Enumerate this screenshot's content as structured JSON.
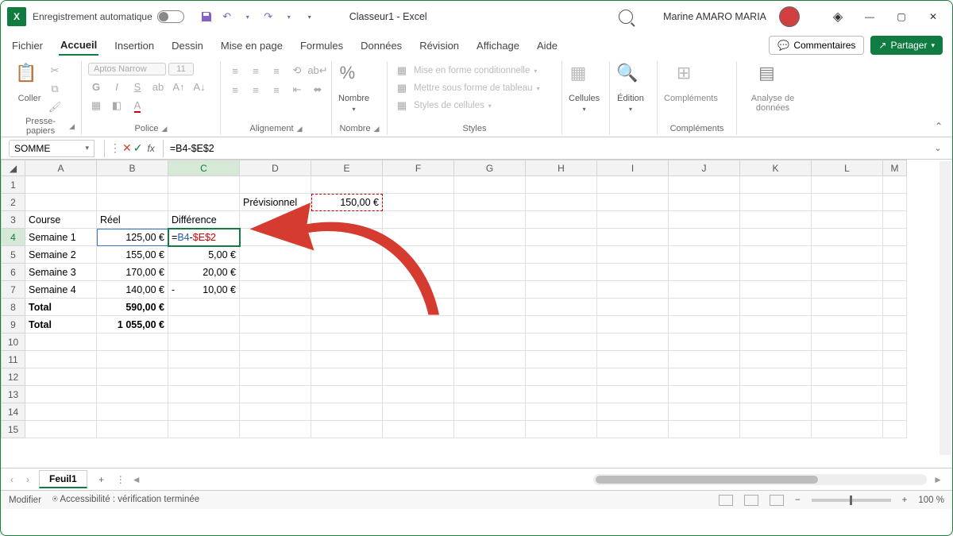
{
  "titlebar": {
    "auto_save": "Enregistrement automatique",
    "doc_title": "Classeur1 - Excel",
    "user": "Marine AMARO MARIA"
  },
  "tabs": {
    "file": "Fichier",
    "home": "Accueil",
    "insert": "Insertion",
    "draw": "Dessin",
    "layout": "Mise en page",
    "formulas": "Formules",
    "data": "Données",
    "review": "Révision",
    "view": "Affichage",
    "help": "Aide",
    "comments": "Commentaires",
    "share": "Partager"
  },
  "ribbon": {
    "clipboard": "Presse-papiers",
    "paste": "Coller",
    "font_group": "Police",
    "font_name": "Aptos Narrow",
    "font_size": "11",
    "align_group": "Alignement",
    "number_group": "Nombre",
    "number_btn": "Nombre",
    "styles_group": "Styles",
    "cond_fmt": "Mise en forme conditionnelle",
    "table_fmt": "Mettre sous forme de tableau",
    "cell_styles": "Styles de cellules",
    "cells_group": "Cellules",
    "cells_btn": "Cellules",
    "edit_group": "Édition",
    "edit_btn": "Édition",
    "addins_group": "Compléments",
    "addins_btn": "Compléments",
    "analyze_group": "",
    "analyze_btn": "Analyse de données"
  },
  "namebox": "SOMME",
  "formula": "=B4-$E$2",
  "columns": [
    "A",
    "B",
    "C",
    "D",
    "E",
    "F",
    "G",
    "H",
    "I",
    "J",
    "K",
    "L",
    "M"
  ],
  "cells": {
    "D2": "Prévisionnel",
    "E2": "150,00 €",
    "A3": "Course",
    "B3": "Réel",
    "C3": "Différence",
    "A4": "Semaine 1",
    "B4": "125,00 €",
    "C4_eq": "=",
    "C4_b": "B4",
    "C4_m": "-",
    "C4_r": "$E$2",
    "A5": "Semaine 2",
    "B5": "155,00 €",
    "C5": "5,00 €",
    "A6": "Semaine 3",
    "B6": "170,00 €",
    "C6": "20,00 €",
    "A7": "Semaine 4",
    "B7": "140,00 €",
    "C7_sign": "-",
    "C7": "10,00 €",
    "A8": "Total",
    "B8": "590,00 €",
    "A9": "Total",
    "B9": "1 055,00 €"
  },
  "sheet_tab": "Feuil1",
  "statusbar": {
    "mode": "Modifier",
    "access": "Accessibilité : vérification terminée",
    "zoom": "100 %"
  },
  "chart_data": {
    "type": "table",
    "title": "Course budget",
    "previsionnel": 150.0,
    "currency": "EUR",
    "rows": [
      {
        "label": "Semaine 1",
        "reel": 125.0,
        "difference_formula": "=B4-$E$2"
      },
      {
        "label": "Semaine 2",
        "reel": 155.0,
        "difference": 5.0
      },
      {
        "label": "Semaine 3",
        "reel": 170.0,
        "difference": 20.0
      },
      {
        "label": "Semaine 4",
        "reel": 140.0,
        "difference": -10.0
      }
    ],
    "totals": [
      590.0,
      1055.0
    ]
  }
}
